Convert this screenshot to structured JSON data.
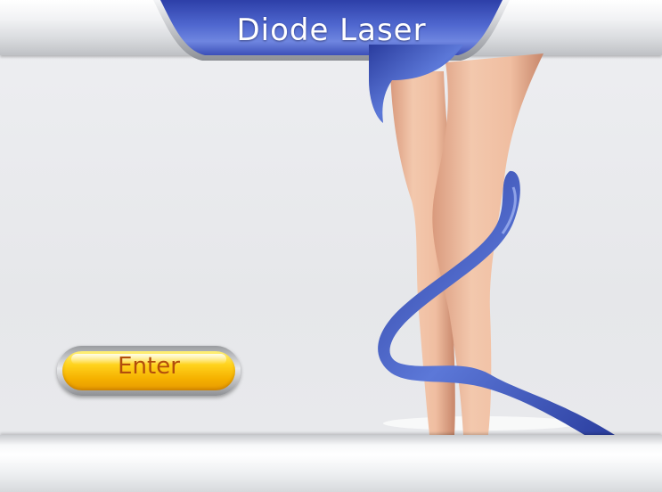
{
  "header": {
    "title": "Diode Laser"
  },
  "actions": {
    "enter_label": "Enter"
  },
  "colors": {
    "accent_blue": "#3a55b8",
    "button_yellow": "#f7c200",
    "button_text": "#b24d0c"
  },
  "icons": {
    "illustration": "legs-with-ribbon-illustration"
  }
}
